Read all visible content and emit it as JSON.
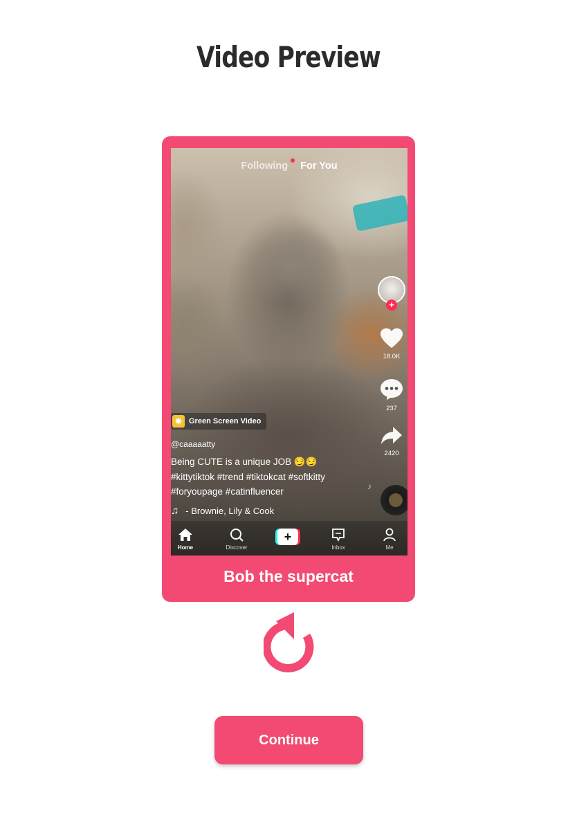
{
  "colors": {
    "accent": "#f24a72",
    "tiktok_red": "#fe2c55",
    "tiktok_cyan": "#25f4ee"
  },
  "page": {
    "title": "Video Preview"
  },
  "preview": {
    "top_tabs": {
      "following": "Following",
      "for_you": "For You"
    },
    "side_actions": {
      "avatar_icon": "creator-avatar",
      "follow_icon": "plus-icon",
      "like_count": "18.0K",
      "comment_count": "237",
      "share_count": "2420"
    },
    "effect_badge": "Green Screen Video",
    "username": "@caaaaatty",
    "caption_line1": "Being CUTE is a unique JOB 😏😏",
    "caption_line2": "#kittytiktok #trend #tiktokcat #softkitty",
    "caption_line3": "#foryoupage #catinfluencer",
    "music": "- Brownie, Lily & Cook",
    "bottom_nav": {
      "home": "Home",
      "discover": "Discover",
      "add": "+",
      "inbox": "Inbox",
      "me": "Me"
    }
  },
  "card": {
    "caption": "Bob the supercat"
  },
  "replay": {
    "icon": "replay-icon"
  },
  "continue_button": {
    "label": "Continue"
  }
}
